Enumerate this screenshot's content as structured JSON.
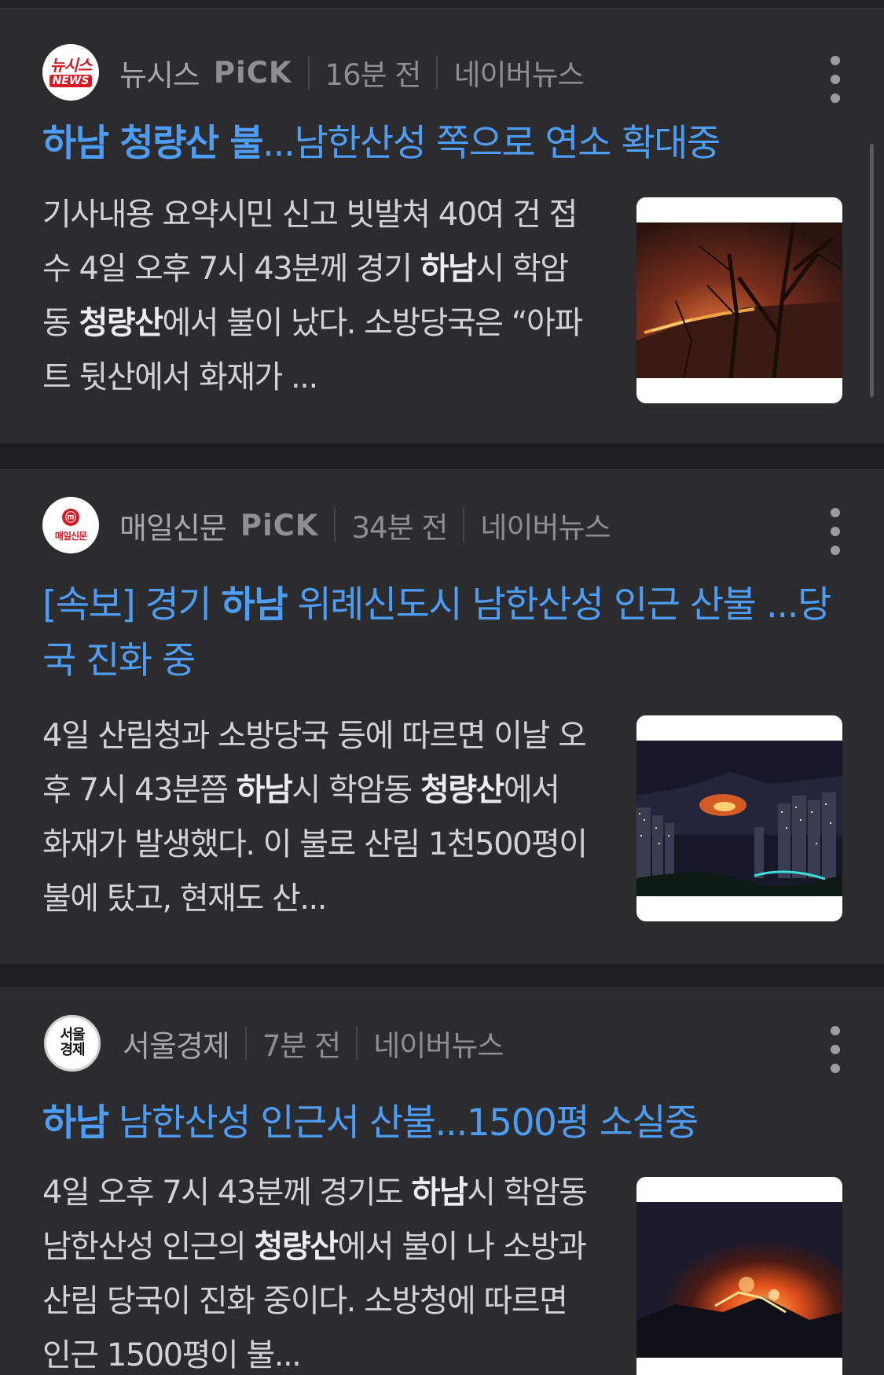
{
  "articles": [
    {
      "press": "뉴시스",
      "logo_lines": [
        "뉴시스",
        "NEWS"
      ],
      "pick": "PiCK",
      "time": "16분 전",
      "source": "네이버뉴스",
      "headline_bold": "하남 청량산 불",
      "headline_rest": "...남한산성 쪽으로 연소 확대중",
      "summary": [
        {
          "t": "기사내용 요약시민 신고 빗발쳐 40여 건 접수 4일 오후 7시 43분께 경기 ",
          "b": false
        },
        {
          "t": "하남",
          "b": true
        },
        {
          "t": "시 학암동 ",
          "b": false
        },
        {
          "t": "청량산",
          "b": true
        },
        {
          "t": "에서 불이 났다. 소방당국은 “아파트 뒷산에서 화재가 ...",
          "b": false
        }
      ],
      "thumb_icon": "forest-fire-photo"
    },
    {
      "press": "매일신문",
      "logo_lines": [
        "매일신문"
      ],
      "pick": "PiCK",
      "time": "34분 전",
      "source": "네이버뉴스",
      "headline_parts": [
        {
          "t": "[속보] 경기 ",
          "b": false
        },
        {
          "t": "하남",
          "b": true
        },
        {
          "t": " 위례신도시 남한산성 인근 산불 ...당국 진화 중",
          "b": false
        }
      ],
      "summary": [
        {
          "t": "4일 산림청과 소방당국 등에 따르면 이날 오후 7시 43분쯤 ",
          "b": false
        },
        {
          "t": "하남",
          "b": true
        },
        {
          "t": "시 학암동 ",
          "b": false
        },
        {
          "t": "청량산",
          "b": true
        },
        {
          "t": "에서 화재가 발생했다. 이 불로 산림 1천500평이 불에 탔고, 현재도 산...",
          "b": false
        }
      ],
      "thumb_icon": "city-night-fire-photo"
    },
    {
      "press": "서울경제",
      "logo_lines": [
        "서울",
        "경제"
      ],
      "time": "7분 전",
      "source": "네이버뉴스",
      "headline_parts": [
        {
          "t": "하남",
          "b": true
        },
        {
          "t": " 남한산성 인근서 산불...1500평 소실중",
          "b": false
        }
      ],
      "summary": [
        {
          "t": "4일 오후 7시 43분께 경기도 ",
          "b": false
        },
        {
          "t": "하남",
          "b": true
        },
        {
          "t": "시 학암동 남한산성 인근의 ",
          "b": false
        },
        {
          "t": "청량산",
          "b": true
        },
        {
          "t": "에서 불이 나 소방과 산림 당국이 진화 중이다. 소방청에 따르면 인근 1500평이 불...",
          "b": false
        }
      ],
      "thumb_icon": "mountain-fire-photo"
    }
  ],
  "colors": {
    "background": "#1f1f21",
    "card": "#2c2c2f",
    "headline": "#4e9df5",
    "summary_text": "#d3d3d6",
    "meta_text": "#8e8e93"
  }
}
